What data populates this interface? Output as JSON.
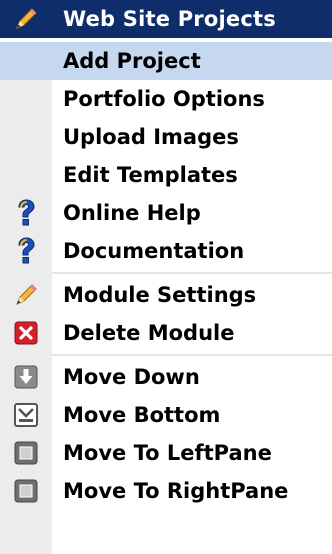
{
  "menu": {
    "header": {
      "label": "Web Site Projects",
      "icon": "pencil-icon"
    },
    "items": [
      {
        "label": "Add Project",
        "icon": null,
        "highlighted": true
      },
      {
        "label": "Portfolio Options",
        "icon": null
      },
      {
        "label": "Upload Images",
        "icon": null
      },
      {
        "label": "Edit Templates",
        "icon": null
      },
      {
        "label": "Online Help",
        "icon": "help-icon"
      },
      {
        "label": "Documentation",
        "icon": "help-icon"
      },
      {
        "label": "Module Settings",
        "icon": "pencil-icon"
      },
      {
        "label": "Delete Module",
        "icon": "delete-icon"
      },
      {
        "label": "Move Down",
        "icon": "move-down-icon"
      },
      {
        "label": "Move Bottom",
        "icon": "move-bottom-icon"
      },
      {
        "label": "Move To LeftPane",
        "icon": "pane-icon"
      },
      {
        "label": "Move To RightPane",
        "icon": "pane-icon"
      }
    ]
  },
  "colors": {
    "header_bg": "#0f2d6b",
    "highlight_bg": "#c6d8ef",
    "gutter_bg": "#ececec",
    "delete_red": "#d21f2b",
    "help_blue": "#1d4fb8",
    "help_yellow": "#f2c21a"
  }
}
